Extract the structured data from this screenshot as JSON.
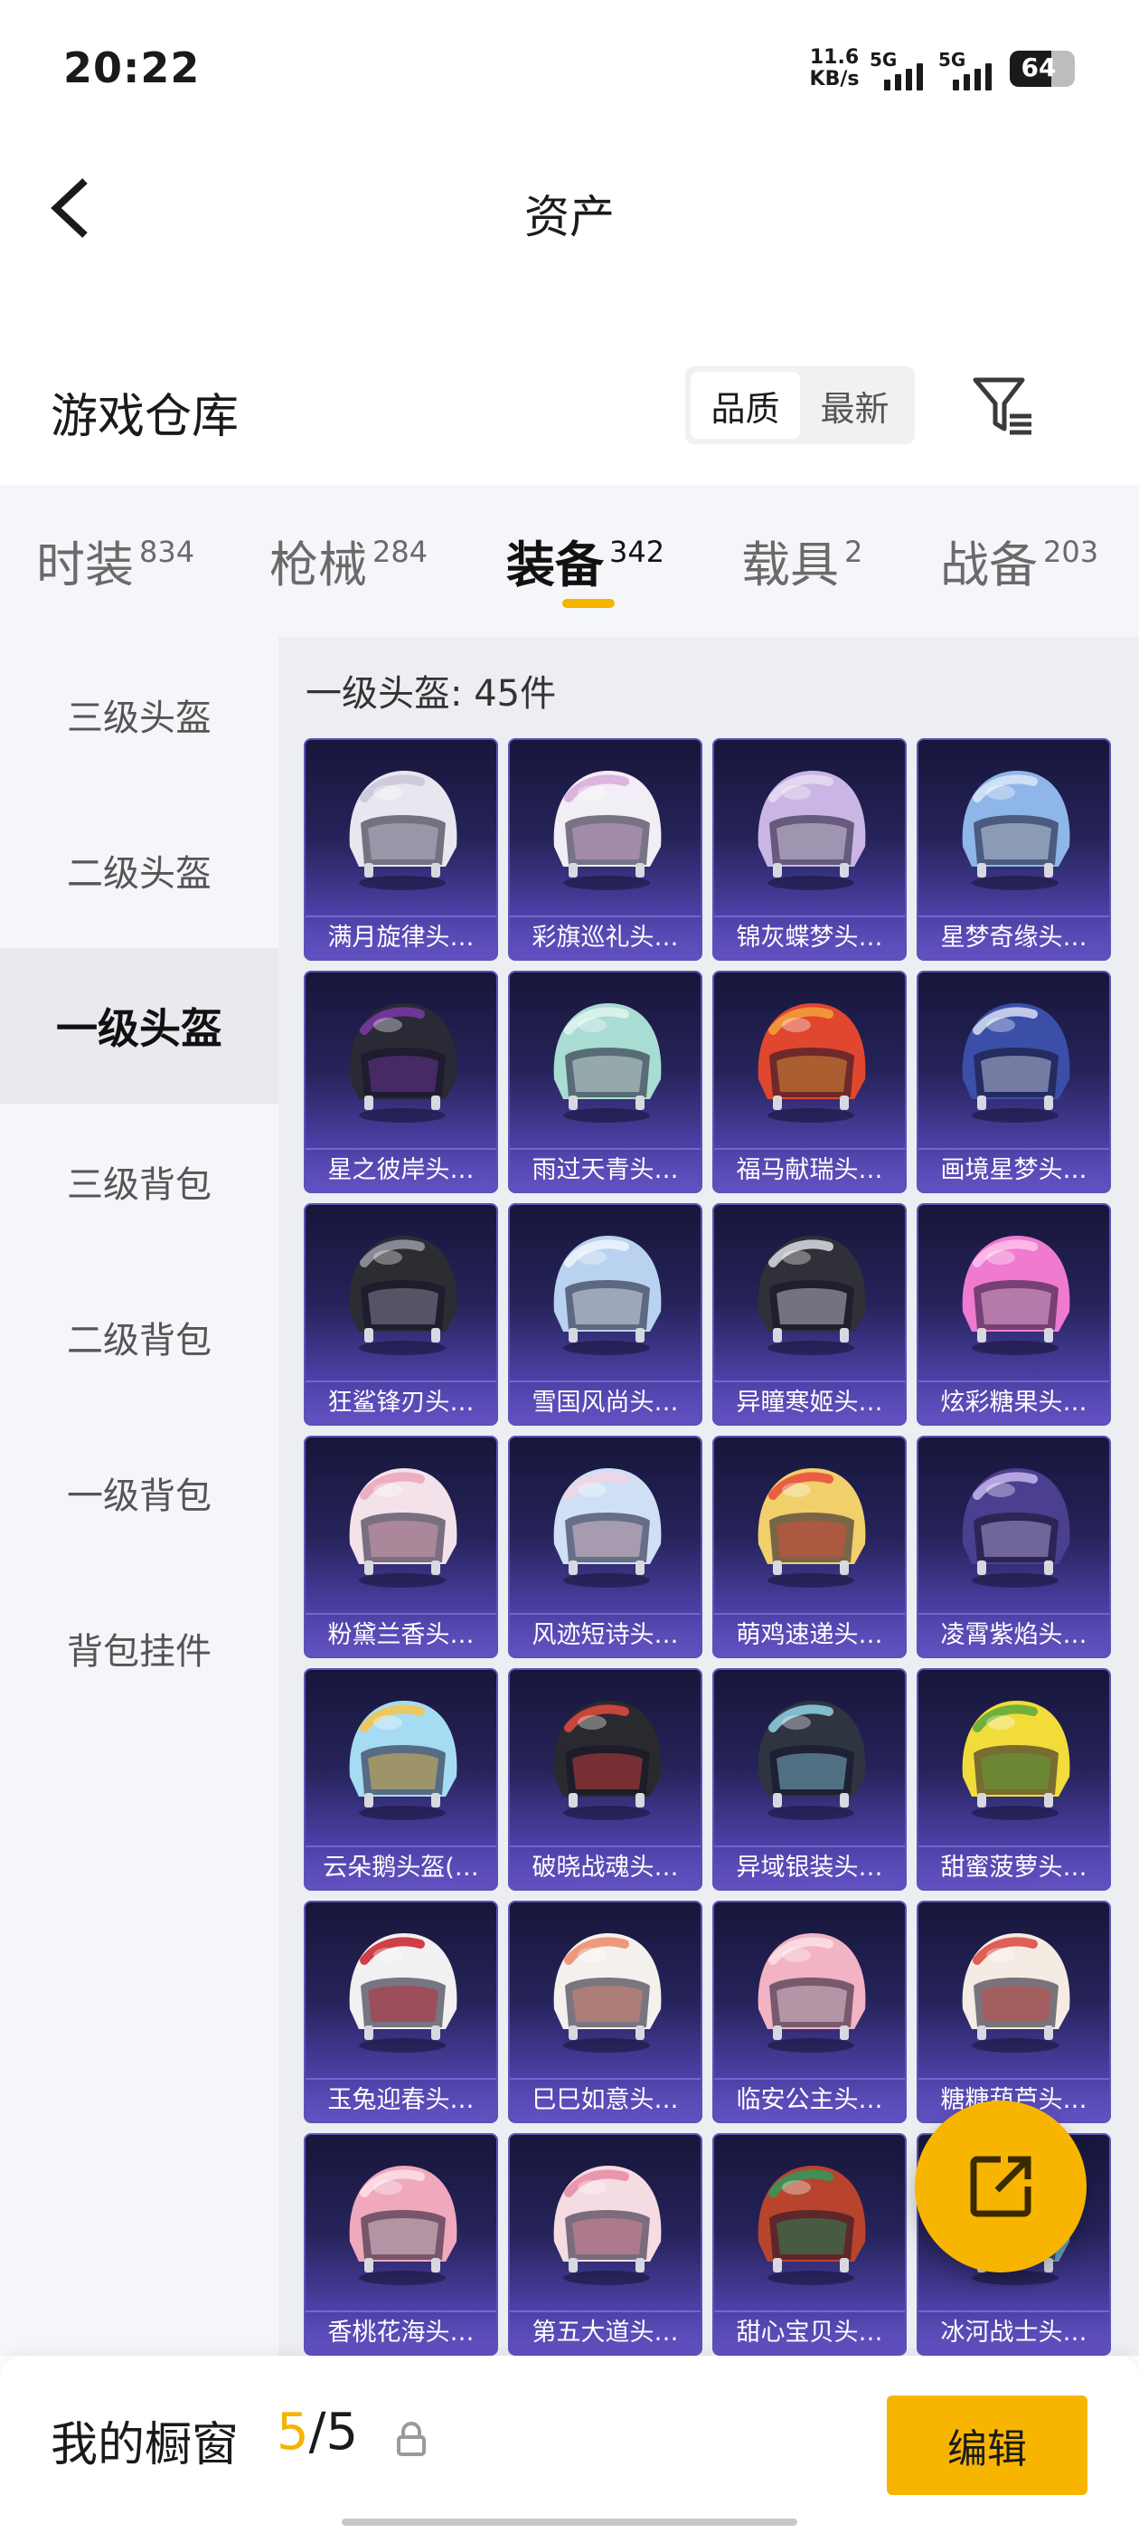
{
  "status_bar": {
    "time": "20:22",
    "net_speed_value": "11.6",
    "net_speed_unit": "KB/s",
    "signal_1_label": "5G",
    "signal_2_label": "5G",
    "battery": "64"
  },
  "header": {
    "title": "资产",
    "back_icon": "chevron-left-icon"
  },
  "section": {
    "title": "游戏仓库",
    "sort_options": [
      "品质",
      "最新"
    ],
    "active_sort": "品质",
    "filter_icon": "filter-icon"
  },
  "tabs": [
    {
      "label": "时装",
      "count": "834"
    },
    {
      "label": "枪械",
      "count": "284"
    },
    {
      "label": "装备",
      "count": "342"
    },
    {
      "label": "载具",
      "count": "2"
    },
    {
      "label": "战备",
      "count": "203"
    }
  ],
  "active_tab": "装备",
  "sidebar": {
    "items": [
      "三级头盔",
      "二级头盔",
      "一级头盔",
      "三级背包",
      "二级背包",
      "一级背包",
      "背包挂件"
    ],
    "active": "一级头盔"
  },
  "grid": {
    "heading": "一级头盔: 45件",
    "items": [
      {
        "name": "满月旋律头…",
        "color": "#e8e6ee",
        "accent": "#c9c4d8"
      },
      {
        "name": "彩旗巡礼头…",
        "color": "#f2eef6",
        "accent": "#d8a9d8"
      },
      {
        "name": "锦灰蝶梦头…",
        "color": "#c9b6e4",
        "accent": "#e6dcf2"
      },
      {
        "name": "星梦奇缘头…",
        "color": "#8fb6e8",
        "accent": "#d9e8f8"
      },
      {
        "name": "星之彼岸头…",
        "color": "#2a2a36",
        "accent": "#7a3aa8"
      },
      {
        "name": "雨过天青头…",
        "color": "#a9dcd3",
        "accent": "#e2f4ef"
      },
      {
        "name": "福马献瑞头…",
        "color": "#e0472e",
        "accent": "#f3a23a"
      },
      {
        "name": "画境星梦头…",
        "color": "#3b4fa8",
        "accent": "#d7def2"
      },
      {
        "name": "狂鲨锋刃头…",
        "color": "#2c2d33",
        "accent": "#9a9aa8"
      },
      {
        "name": "雪国风尚头…",
        "color": "#b8d2ef",
        "accent": "#eef5fc"
      },
      {
        "name": "异瞳寒姬头…",
        "color": "#303038",
        "accent": "#dadce4"
      },
      {
        "name": "炫彩糖果头…",
        "color": "#f07ad0",
        "accent": "#ffc2ea"
      },
      {
        "name": "粉黛兰香头…",
        "color": "#f3e2ea",
        "accent": "#e9a5bb"
      },
      {
        "name": "风迹短诗头…",
        "color": "#cfe0f5",
        "accent": "#f2d3e3"
      },
      {
        "name": "萌鸡速递头…",
        "color": "#f1cf6b",
        "accent": "#e84a3a"
      },
      {
        "name": "凌霄紫焰头…",
        "color": "#4b3f8f",
        "accent": "#c5b6ee"
      },
      {
        "name": "云朵鹅头盔(…",
        "color": "#a6dcf3",
        "accent": "#f4c64a"
      },
      {
        "name": "破晓战魂头…",
        "color": "#2a2a2e",
        "accent": "#e24a3e"
      },
      {
        "name": "异域银装头…",
        "color": "#2e3440",
        "accent": "#8fd3e6"
      },
      {
        "name": "甜蜜菠萝头…",
        "color": "#f1dc3a",
        "accent": "#5aa83a"
      },
      {
        "name": "玉兔迎春头…",
        "color": "#f2f0f0",
        "accent": "#c8202a"
      },
      {
        "name": "巳巳如意头…",
        "color": "#f4f0ee",
        "accent": "#ec8a6a"
      },
      {
        "name": "临安公主头…",
        "color": "#f2b3c4",
        "accent": "#fbe1e8"
      },
      {
        "name": "糖糖葫芦头…",
        "color": "#f4ebe2",
        "accent": "#d8473e"
      },
      {
        "name": "香桃花海头…",
        "color": "#f0a8bd",
        "accent": "#fbe2ea"
      },
      {
        "name": "第五大道头…",
        "color": "#f5dce3",
        "accent": "#e88aa2"
      },
      {
        "name": "甜心宝贝头…",
        "color": "#b8442e",
        "accent": "#2f9a5a"
      },
      {
        "name": "冰河战士头…",
        "color": "#6aa0c8",
        "accent": "#d8e8f4"
      }
    ]
  },
  "fab": {
    "icon": "share-icon"
  },
  "bottom_bar": {
    "title": "我的橱窗",
    "count_current": "5",
    "count_sep_total": "/5",
    "lock_icon": "lock-icon",
    "edit_label": "编辑"
  }
}
